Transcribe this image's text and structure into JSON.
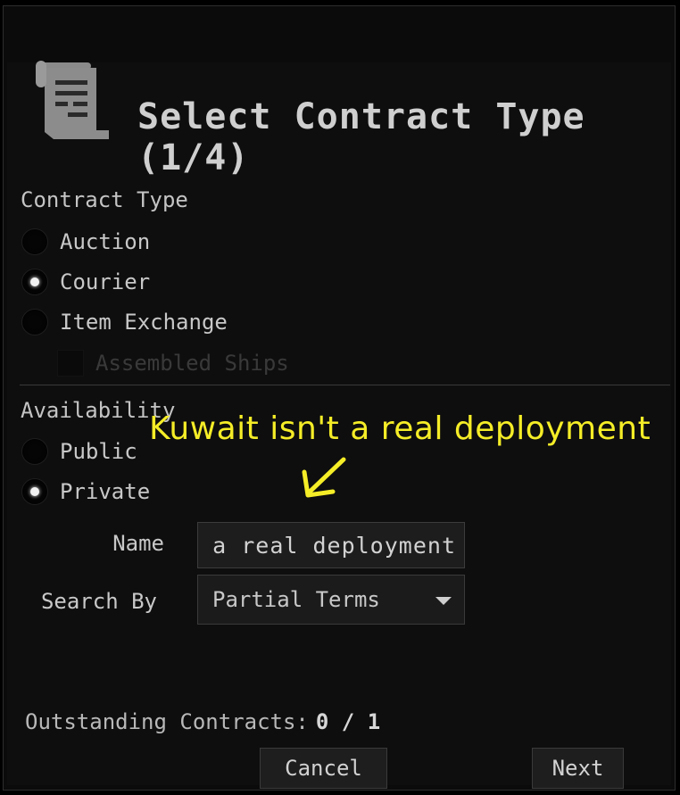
{
  "header": {
    "title": "Select Contract Type (1/4)",
    "icon": "contract-scroll-icon"
  },
  "contract_type": {
    "label": "Contract Type",
    "options": [
      {
        "label": "Auction",
        "selected": false
      },
      {
        "label": "Courier",
        "selected": true
      },
      {
        "label": "Item Exchange",
        "selected": false
      }
    ],
    "assembled_ships": {
      "label": "Assembled Ships",
      "checked": false,
      "disabled": true
    }
  },
  "availability": {
    "label": "Availability",
    "options": [
      {
        "label": "Public",
        "selected": false
      },
      {
        "label": "Private",
        "selected": true
      }
    ]
  },
  "annotation": {
    "text": "Kuwait isn't a real deployment",
    "color": "#f5ed27"
  },
  "name_field": {
    "label": "Name",
    "value": "'t a real deployment"
  },
  "search_by": {
    "label": "Search By",
    "value": "Partial Terms"
  },
  "outstanding": {
    "label": "Outstanding Contracts:",
    "value": "0 / 1"
  },
  "buttons": {
    "cancel": "Cancel",
    "next": "Next"
  }
}
